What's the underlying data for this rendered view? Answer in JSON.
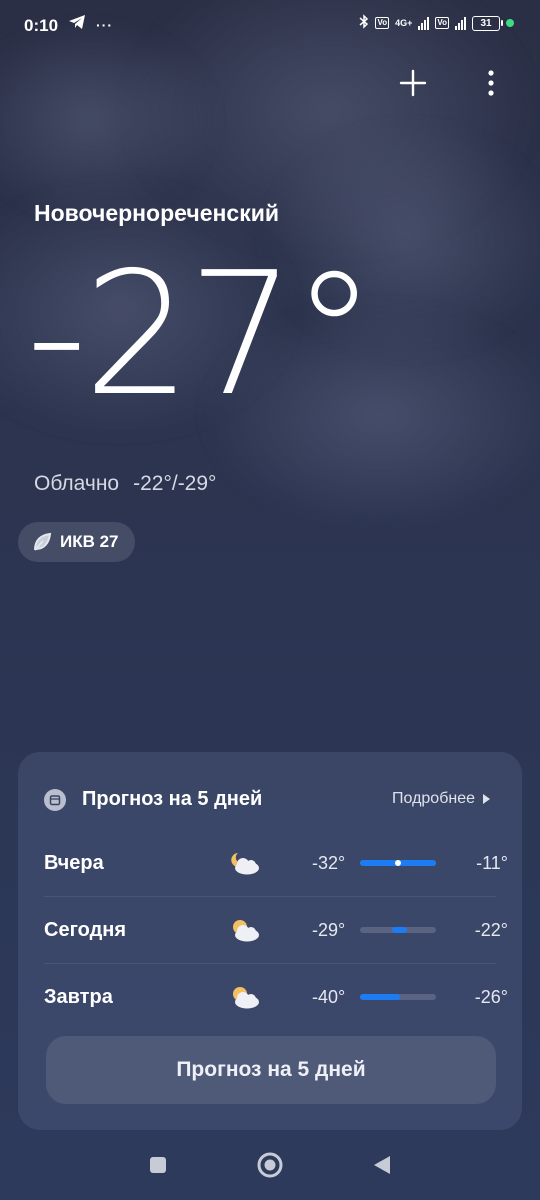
{
  "status": {
    "time": "0:10",
    "battery": "31",
    "net": "4G+"
  },
  "location": {
    "city": "Новочернореченский"
  },
  "current": {
    "temp": "-27°",
    "condition": "Облачно",
    "range": "-22°/-29°"
  },
  "aqi": {
    "label": "ИКВ 27"
  },
  "forecast": {
    "title": "Прогноз на 5 дней",
    "more": "Подробнее",
    "rows": [
      {
        "day": "Вчера",
        "icon": "partly-cloudy-night-icon",
        "low": "-32°",
        "high": "-11°",
        "bar_start": 0.0,
        "bar_end": 1.0,
        "current_marker": 0.5
      },
      {
        "day": "Сегодня",
        "icon": "partly-cloudy-day-icon",
        "low": "-29°",
        "high": "-22°",
        "bar_start": 0.42,
        "bar_end": 0.62
      },
      {
        "day": "Завтра",
        "icon": "partly-cloudy-day-icon",
        "low": "-40°",
        "high": "-26°",
        "bar_start": 0.0,
        "bar_end": 0.52
      }
    ],
    "button": "Прогноз на 5 дней"
  },
  "colors": {
    "accent": "#1d7cf2"
  }
}
